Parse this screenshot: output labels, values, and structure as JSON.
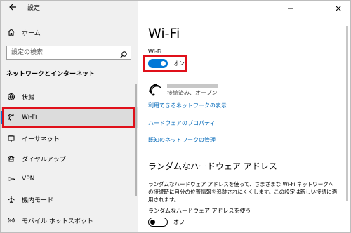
{
  "window": {
    "title": "設定"
  },
  "sidebar": {
    "home": "ホーム",
    "search_placeholder": "設定の検索",
    "section": "ネットワークとインターネット",
    "items": [
      {
        "label": "状態",
        "icon": "globe-status-icon"
      },
      {
        "label": "Wi-Fi",
        "icon": "wifi-icon",
        "selected": true
      },
      {
        "label": "イーサネット",
        "icon": "ethernet-icon"
      },
      {
        "label": "ダイヤルアップ",
        "icon": "dialup-icon"
      },
      {
        "label": "VPN",
        "icon": "vpn-icon"
      },
      {
        "label": "機内モード",
        "icon": "airplane-icon"
      },
      {
        "label": "モバイル ホットスポット",
        "icon": "hotspot-icon"
      }
    ]
  },
  "main": {
    "title": "Wi-Fi",
    "wifi_label": "Wi-Fi",
    "wifi_toggle": {
      "on": true,
      "text": "オン"
    },
    "network": {
      "status": "接続済み、オープン"
    },
    "links": [
      "利用できるネットワークの表示",
      "ハードウェアのプロパティ",
      "既知のネットワークの管理"
    ],
    "random_hw": {
      "heading": "ランダムなハードウェア アドレス",
      "description": "ランダムなハードウェア アドレスを使って、さまざまな Wi-Fi ネットワークへの接続時に自分の位置情報を追跡されにくくします。この設定は新しい接続に適用されます。",
      "option_label": "ランダムなハードウェア アドレスを使う",
      "toggle": {
        "on": false,
        "text": "オフ"
      }
    }
  },
  "colors": {
    "accent": "#0078d7",
    "link": "#0067b8",
    "highlight": "#e0101a",
    "sidebar_bg": "#f0f0f0"
  }
}
